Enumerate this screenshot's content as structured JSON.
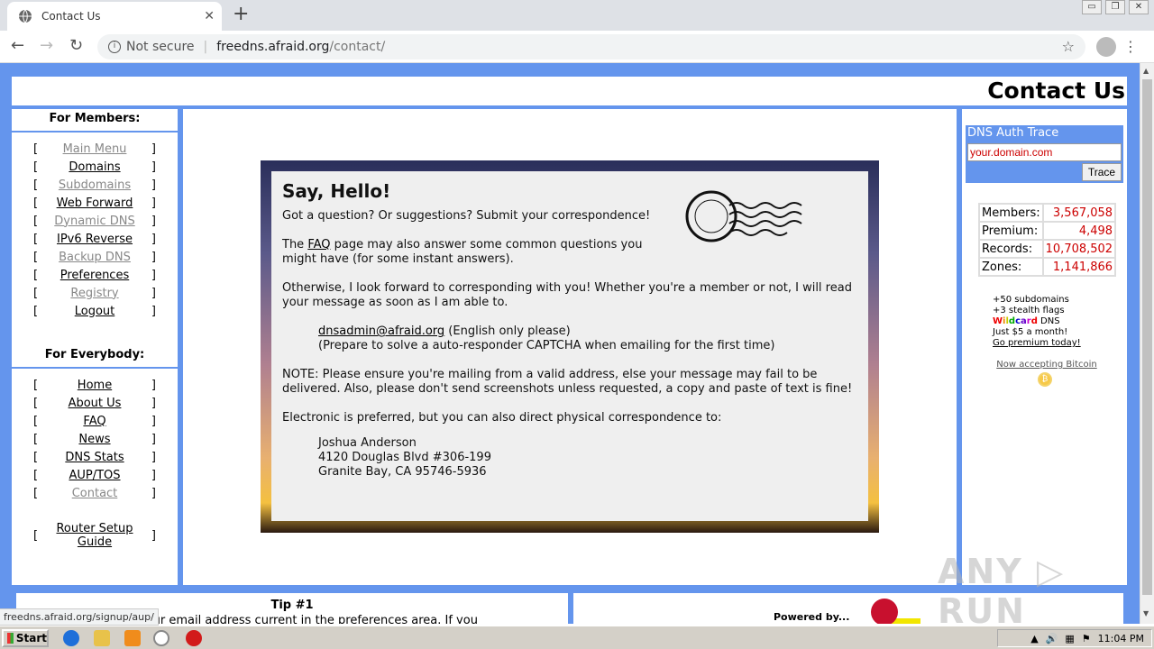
{
  "browser": {
    "tab_title": "Contact Us",
    "tab_close": "✕",
    "new_tab": "+",
    "not_secure": "Not secure",
    "url_host": "freedns.afraid.org",
    "url_path": "/contact/",
    "win_buttons": [
      "▭",
      "❐",
      "✕"
    ]
  },
  "page": {
    "title": "Contact Us",
    "members_title": "For Members:",
    "members_links": [
      {
        "label": "Main Menu"
      },
      {
        "label": "Domains"
      },
      {
        "label": "Subdomains"
      },
      {
        "label": "Web Forward"
      },
      {
        "label": "Dynamic DNS"
      },
      {
        "label": "IPv6 Reverse"
      },
      {
        "label": "Backup DNS"
      },
      {
        "label": "Preferences"
      },
      {
        "label": "Registry"
      },
      {
        "label": "Logout"
      }
    ],
    "everybody_title": "For Everybody:",
    "everybody_links": [
      {
        "label": "Home"
      },
      {
        "label": "About Us"
      },
      {
        "label": "FAQ"
      },
      {
        "label": "News"
      },
      {
        "label": "DNS Stats"
      },
      {
        "label": "AUP/TOS"
      },
      {
        "label": "Contact"
      }
    ],
    "router_link": "Router Setup Guide",
    "bracket_open": "[",
    "bracket_close": "]"
  },
  "letter": {
    "heading": "Say, Hello!",
    "intro": "Got a question? Or suggestions? Submit your correspondence!",
    "faq_prefix": "The ",
    "faq_link": "FAQ",
    "faq_suffix": " page may also answer some common questions you might have (for some instant answers).",
    "otherwise": "Otherwise, I look forward to corresponding with you! Whether you're a member or not, I will read your message as soon as I am able to.",
    "email": "dnsadmin@afraid.org",
    "email_note": " (English only please)",
    "captcha_note": "(Prepare to solve a auto-responder CAPTCHA when emailing for the first time)",
    "note": "NOTE: Please ensure you're mailing from a valid address, else your message may fail to be delivered. Also, please don't send screenshots unless requested, a copy and paste of text is fine!",
    "physical": "Electronic is preferred, but you can also direct physical correspondence to:",
    "address_name": "Joshua Anderson",
    "address_street": "4120 Douglas Blvd #306-199",
    "address_city": "Granite Bay, CA 95746-5936"
  },
  "sidebar_right": {
    "trace_title": "DNS Auth Trace",
    "trace_value": "your.domain.com",
    "trace_button": "Trace",
    "stats": [
      {
        "label": "Members:",
        "value": "3,567,058"
      },
      {
        "label": "Premium:",
        "value": "4,498"
      },
      {
        "label": "Records:",
        "value": "10,708,502"
      },
      {
        "label": "Zones:",
        "value": "1,141,866"
      }
    ],
    "promo_lines": [
      "+50 subdomains",
      "+3 stealth flags"
    ],
    "promo_wildcard": "Wildcard",
    "promo_dns": " DNS",
    "promo_price": "Just $5 a month!",
    "promo_link": "Go premium today!",
    "bitcoin": "Now accepting Bitcoin"
  },
  "bottom": {
    "tip_title": "Tip #1",
    "tip_text": "your email address current in the preferences area. If you",
    "powered_by": "Powered by..."
  },
  "status_url": "freedns.afraid.org/signup/aup/",
  "watermark": "ANY ▷ RUN",
  "taskbar": {
    "start": "Start",
    "clock": "11:04 PM"
  }
}
